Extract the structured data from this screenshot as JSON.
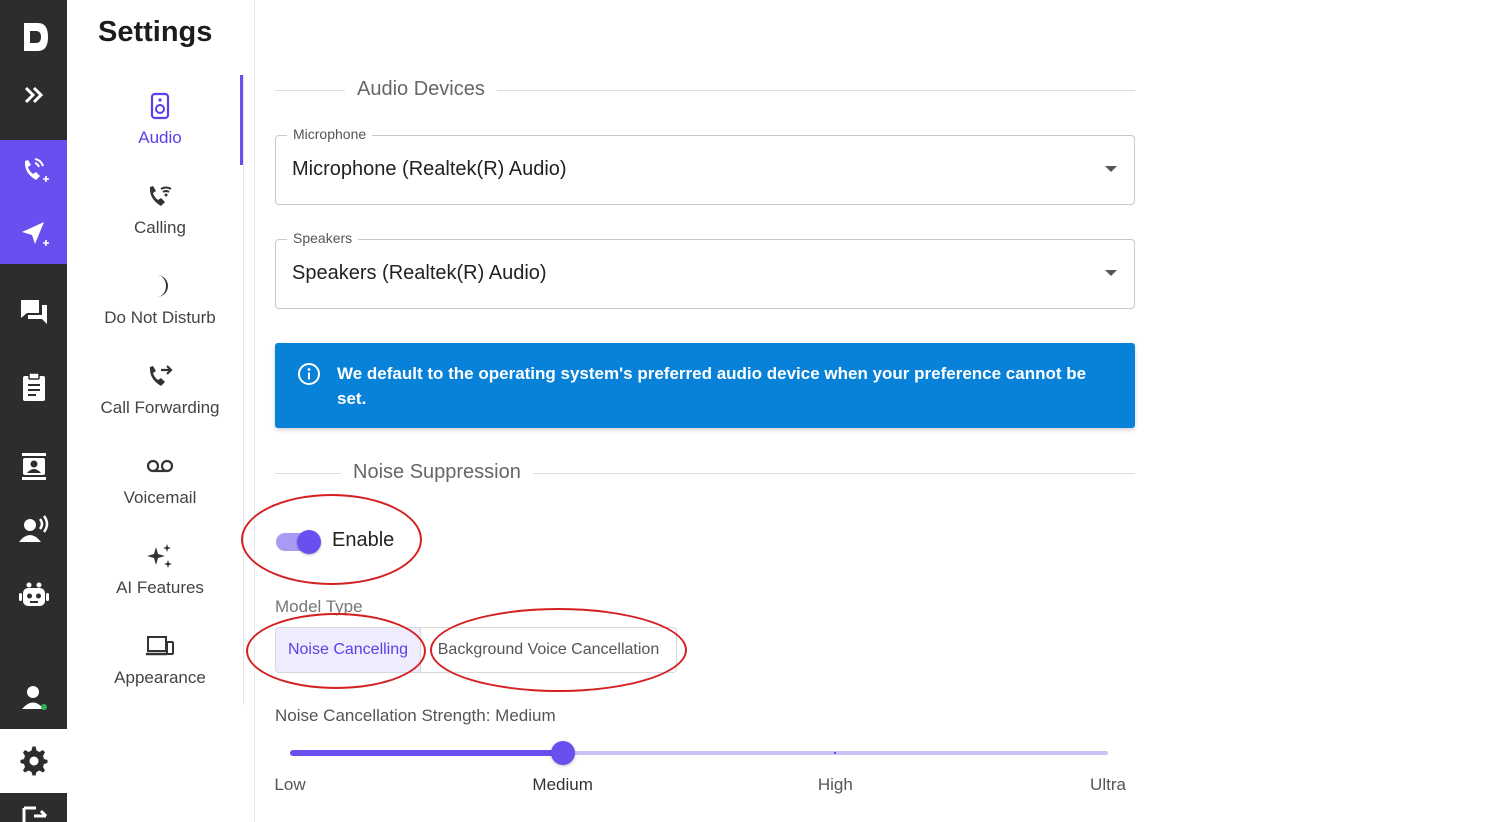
{
  "rail": {
    "items": [
      {
        "name": "logo",
        "icon": "dialpad-logo-icon"
      },
      {
        "name": "expand",
        "icon": "double-chevron-right-icon"
      },
      {
        "name": "new-call",
        "icon": "phone-plus-icon"
      },
      {
        "name": "new-message",
        "icon": "send-plus-icon"
      },
      {
        "name": "messages",
        "icon": "chat-icon"
      },
      {
        "name": "tasks",
        "icon": "clipboard-icon"
      },
      {
        "name": "contacts",
        "icon": "contact-card-icon"
      },
      {
        "name": "voice",
        "icon": "person-speaking-icon"
      },
      {
        "name": "bots",
        "icon": "robot-icon"
      },
      {
        "name": "profile",
        "icon": "user-status-icon"
      },
      {
        "name": "settings",
        "icon": "gear-icon"
      },
      {
        "name": "exit",
        "icon": "logout-icon"
      }
    ],
    "accent_color": "#6b4ef0",
    "background_color": "#2d2d2d"
  },
  "settings": {
    "title": "Settings",
    "nav": [
      {
        "label": "Audio",
        "icon": "speaker-icon",
        "active": true
      },
      {
        "label": "Calling",
        "icon": "phone-wifi-icon",
        "active": false
      },
      {
        "label": "Do Not Disturb",
        "icon": "moon-icon",
        "active": false
      },
      {
        "label": "Call Forwarding",
        "icon": "phone-forward-icon",
        "active": false
      },
      {
        "label": "Voicemail",
        "icon": "voicemail-icon",
        "active": false
      },
      {
        "label": "AI Features",
        "icon": "sparkles-icon",
        "active": false
      },
      {
        "label": "Appearance",
        "icon": "devices-icon",
        "active": false
      }
    ]
  },
  "audio_devices": {
    "heading": "Audio Devices",
    "microphone": {
      "label": "Microphone",
      "value": "Microphone (Realtek(R) Audio)"
    },
    "speakers": {
      "label": "Speakers",
      "value": "Speakers (Realtek(R) Audio)"
    },
    "info": "We default to the operating system's preferred audio device when your preference cannot be set.",
    "info_color": "#0882d8"
  },
  "noise_suppression": {
    "heading": "Noise Suppression",
    "enable_label": "Enable",
    "enabled": true,
    "model_type_label": "Model Type",
    "model_options": [
      "Noise Cancelling",
      "Background Voice Cancellation"
    ],
    "selected_model": "Noise Cancelling",
    "strength_label": "Noise Cancellation Strength: Medium",
    "strength_levels": [
      "Low",
      "Medium",
      "High",
      "Ultra"
    ],
    "strength_selected_index": 1
  },
  "annotation_color": "#d42020"
}
